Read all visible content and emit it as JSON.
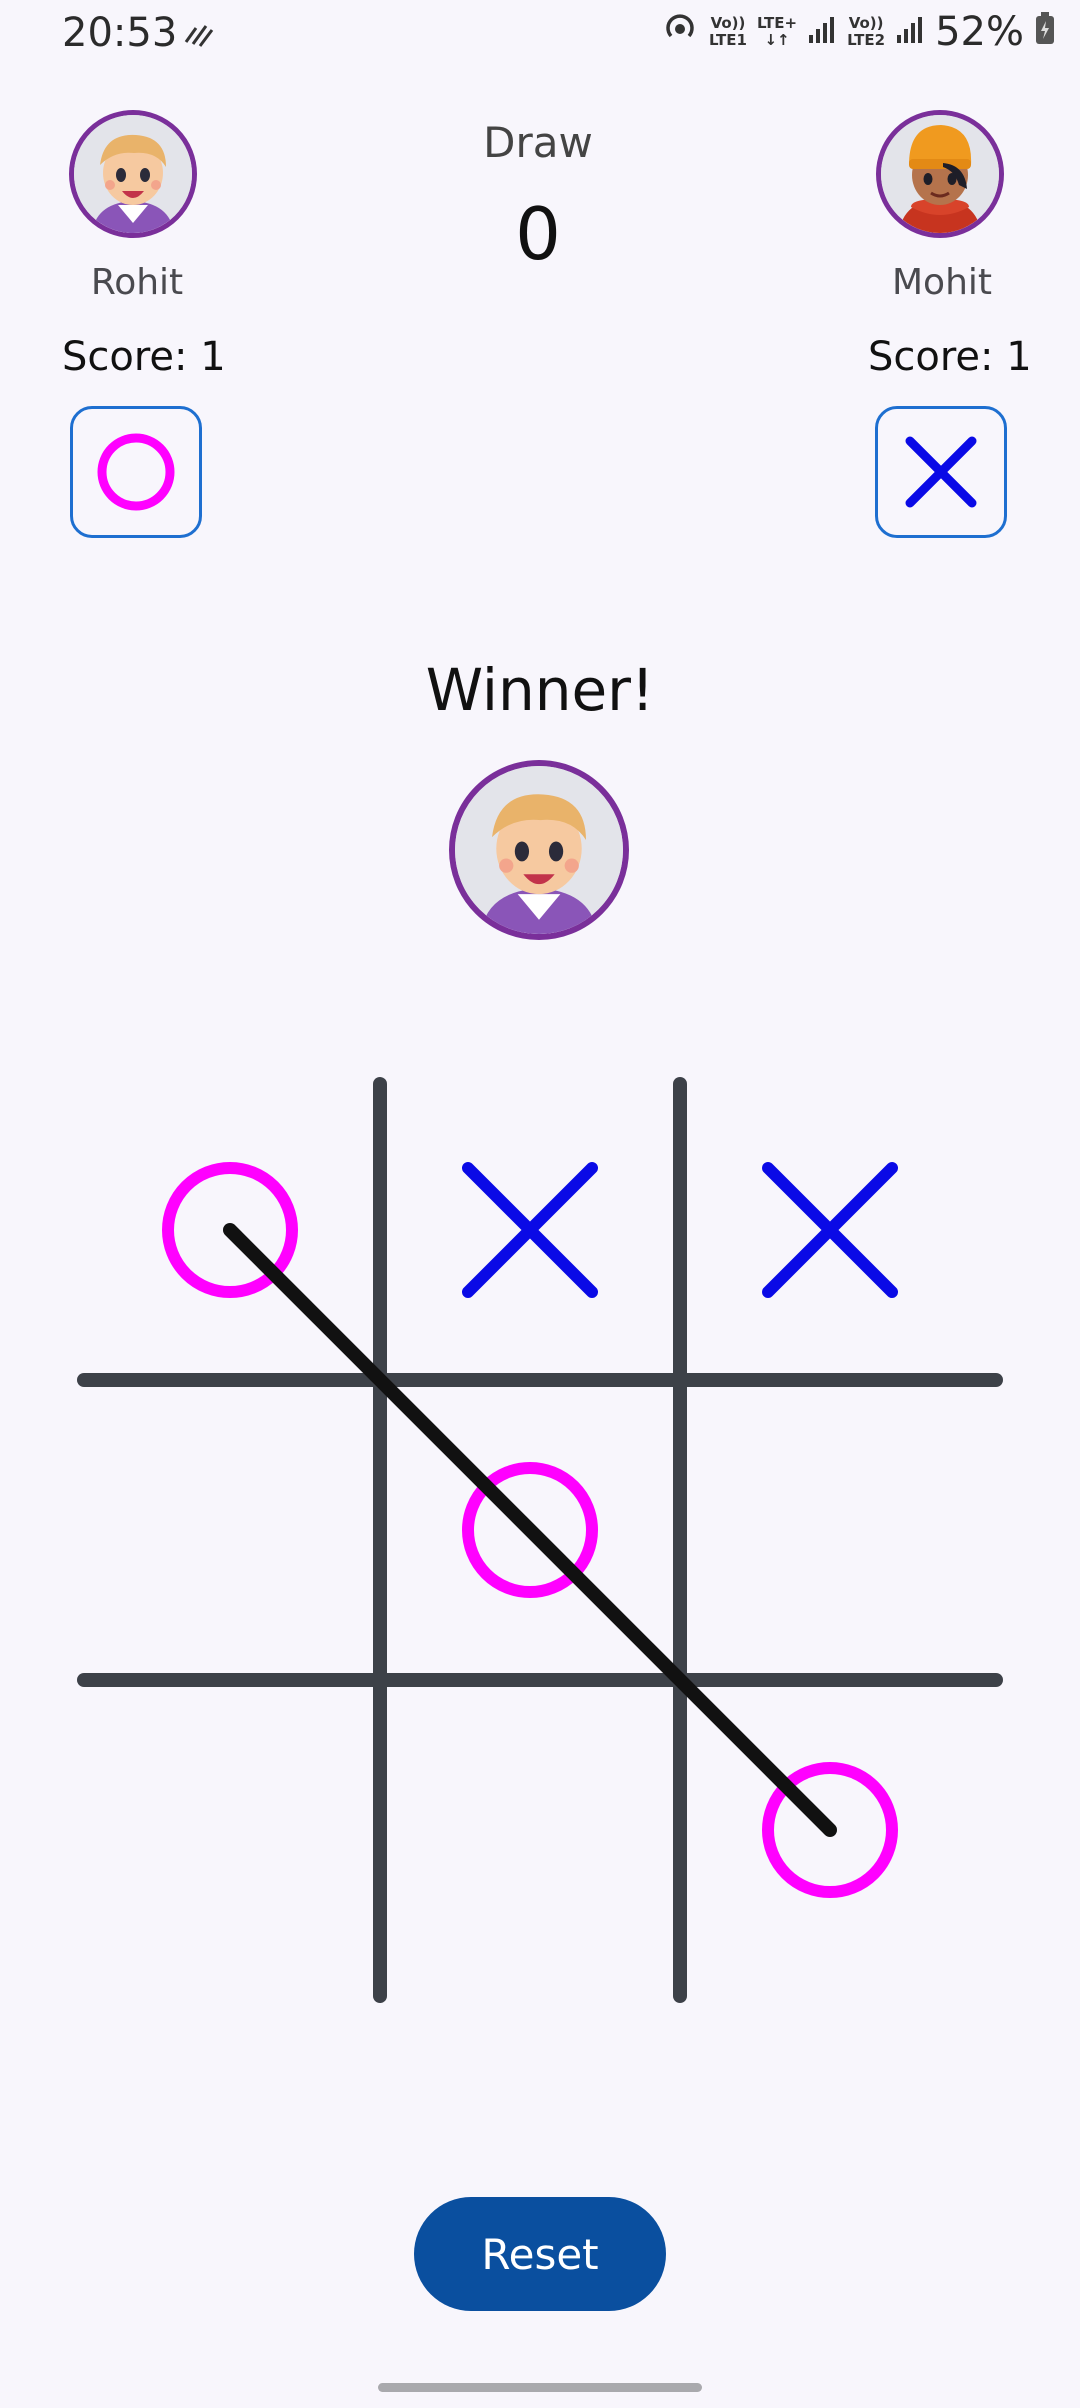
{
  "status_bar": {
    "time": "20:53",
    "net1_top": "Vo))",
    "net1_bottom": "LTE1",
    "net2_top": "LTE+",
    "net2_bottom": "↓↑",
    "net3_top": "Vo))",
    "net3_bottom": "LTE2",
    "battery": "52%"
  },
  "players": {
    "left": {
      "name": "Rohit",
      "score_text": "Score: 1",
      "mark": "O"
    },
    "right": {
      "name": "Mohit",
      "score_text": "Score: 1",
      "mark": "X"
    }
  },
  "draw": {
    "label": "Draw",
    "value": "0"
  },
  "result": {
    "title": "Winner!",
    "winner": "Rohit"
  },
  "board": {
    "cells": [
      "O",
      "X",
      "X",
      "",
      "O",
      "",
      "",
      "",
      "O"
    ],
    "winning_line": [
      0,
      4,
      8
    ]
  },
  "colors": {
    "o": "#ff00ff",
    "x": "#0a0ae6",
    "grid": "#3d4148",
    "win_line": "#111111",
    "button": "#0a4f9f"
  },
  "reset_label": "Reset"
}
